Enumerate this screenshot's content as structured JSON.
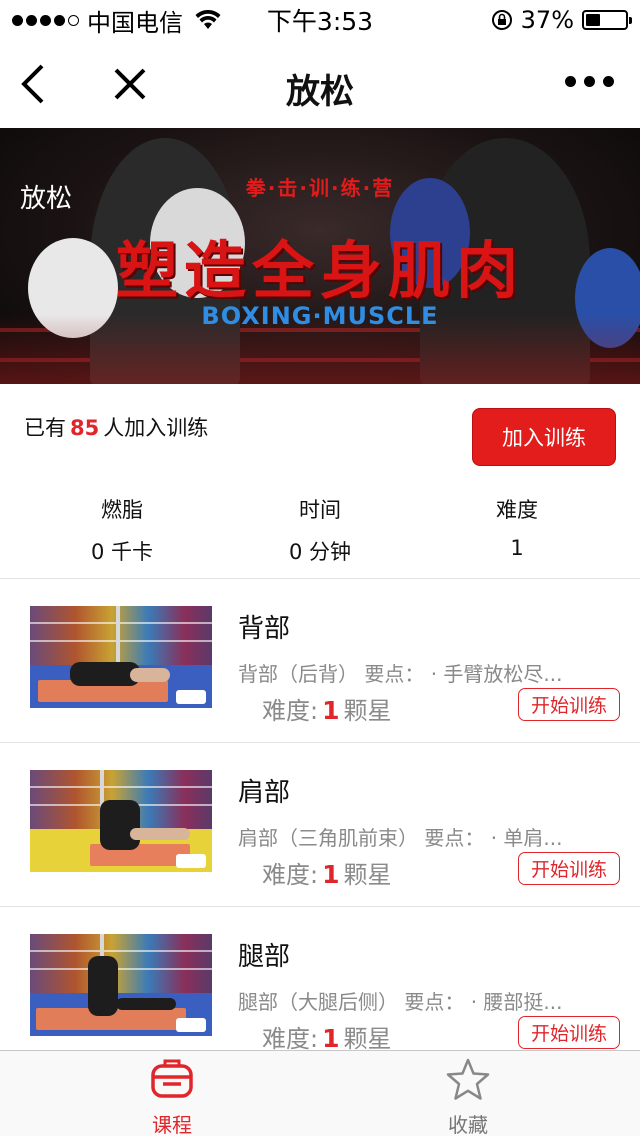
{
  "status_bar": {
    "carrier": "中国电信",
    "time": "下午3:53",
    "battery_text": "37%",
    "battery_level": 0.37
  },
  "nav": {
    "title": "放松"
  },
  "banner": {
    "label": "放松",
    "camp_text": "拳·击·训·练·营",
    "headline": "塑造全身肌肉",
    "subline": "BOXING·MUSCLE"
  },
  "join": {
    "prefix": "已有",
    "count": "85",
    "suffix": "人加入训练",
    "button_label": "加入训练"
  },
  "stats": [
    {
      "label": "燃脂",
      "value": "0 千卡"
    },
    {
      "label": "时间",
      "value": "0 分钟"
    },
    {
      "label": "难度",
      "value": "1"
    }
  ],
  "courses": [
    {
      "name": "背部",
      "desc": "背部（后背） 要点： · 手臂放松尽...",
      "diff_label": "难度:",
      "diff_value": "1",
      "diff_unit": "颗星",
      "button": "开始训练"
    },
    {
      "name": "肩部",
      "desc": "肩部（三角肌前束） 要点： · 单肩...",
      "diff_label": "难度:",
      "diff_value": "1",
      "diff_unit": "颗星",
      "button": "开始训练"
    },
    {
      "name": "腿部",
      "desc": "腿部（大腿后侧） 要点： · 腰部挺...",
      "diff_label": "难度:",
      "diff_value": "1",
      "diff_unit": "颗星",
      "button": "开始训练"
    }
  ],
  "tabbar": {
    "tabs": [
      {
        "label": "课程",
        "icon": "course-icon",
        "active": true
      },
      {
        "label": "收藏",
        "icon": "star-icon",
        "active": false
      }
    ]
  },
  "colors": {
    "accent": "#e0262b",
    "button_bg": "#e31c1c"
  }
}
